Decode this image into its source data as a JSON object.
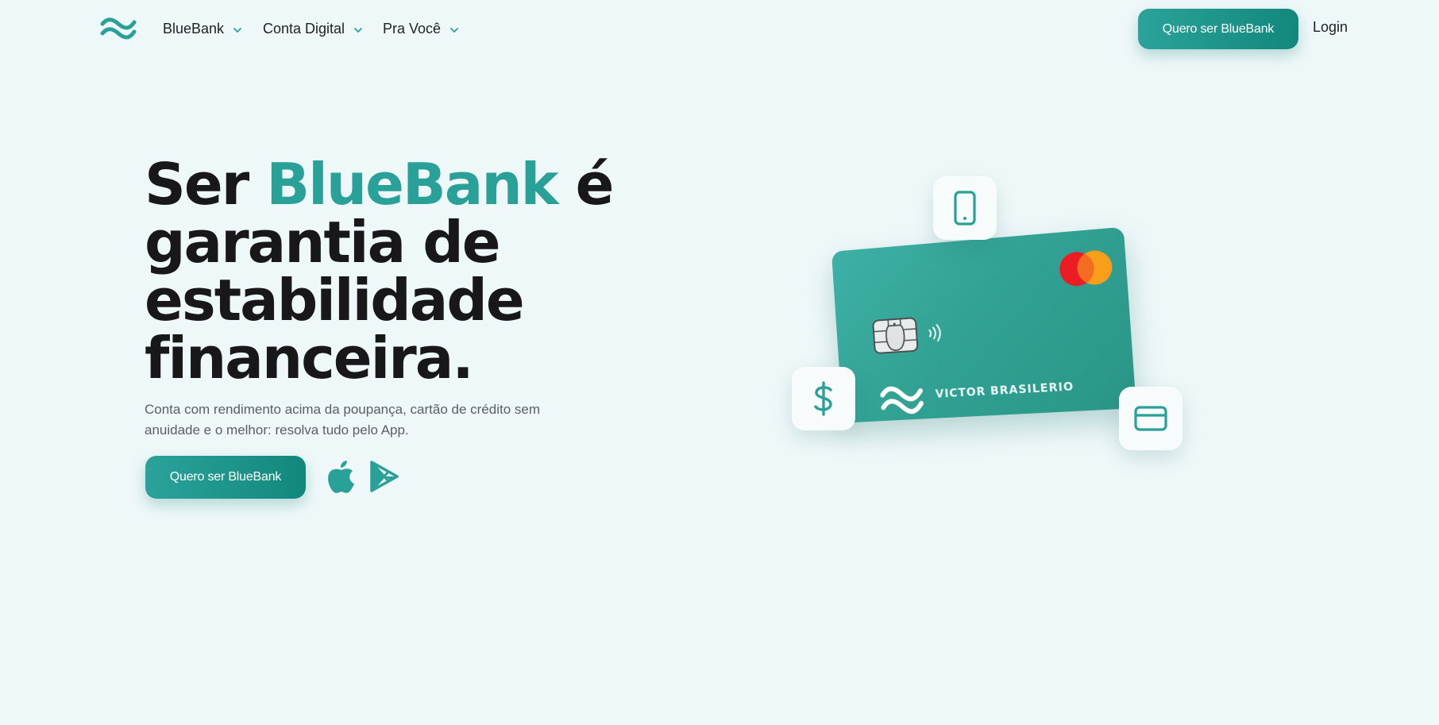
{
  "nav": {
    "items": [
      {
        "label": "BlueBank"
      },
      {
        "label": "Conta Digital"
      },
      {
        "label": "Pra Você"
      }
    ],
    "cta_label": "Quero ser BlueBank",
    "login_label": "Login"
  },
  "hero": {
    "title_pre": "Ser ",
    "title_accent": "BlueBank",
    "title_post": " é garantia de estabilidade financeira.",
    "subtitle": "Conta com rendimento acima da poupança, cartão de crédito sem anuidade e o melhor: resolva tudo pelo App.",
    "cta_label": "Quero ser BlueBank"
  },
  "card": {
    "holder_name": "VICTOR BRASILERIO",
    "brand": "mastercard"
  },
  "icons": {
    "logo": "wave-logo-icon",
    "stores": [
      "apple-store-icon",
      "google-play-icon"
    ],
    "tiles": [
      "smartphone-icon",
      "dollar-icon",
      "credit-card-icon"
    ]
  },
  "colors": {
    "background": "#eff8f9",
    "accent": "#2aa198",
    "button_start": "#2ba39a",
    "button_end": "#12877c",
    "text_dark": "#18181b",
    "text_muted": "#5b5e64"
  }
}
